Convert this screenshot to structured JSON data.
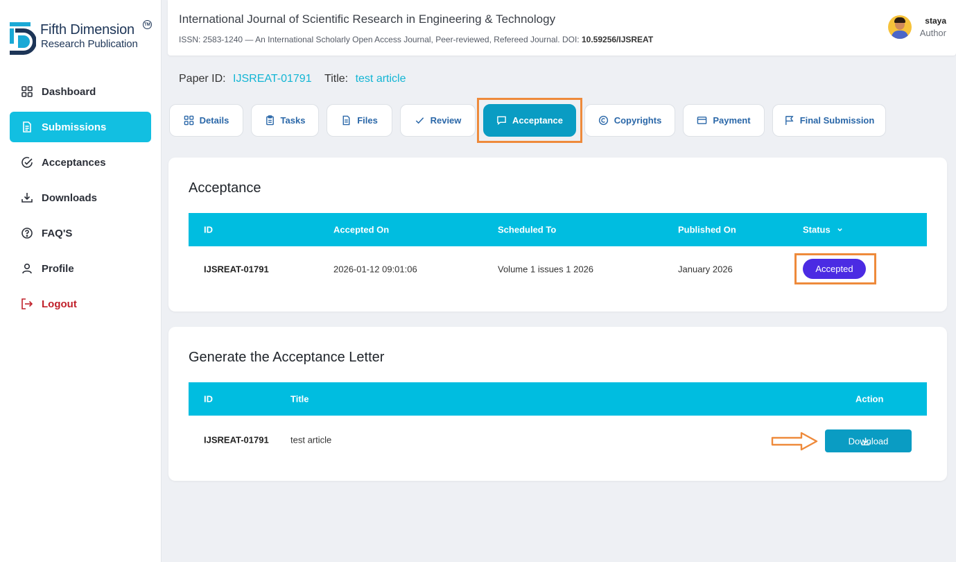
{
  "brand": {
    "line1": "Fifth Dimension",
    "line2": "Research Publication",
    "tm": "TM"
  },
  "sidebar": {
    "items": [
      {
        "label": "Dashboard",
        "icon": "grid-icon",
        "active": false
      },
      {
        "label": "Submissions",
        "icon": "document-icon",
        "active": true
      },
      {
        "label": "Acceptances",
        "icon": "check-circle-icon",
        "active": false
      },
      {
        "label": "Downloads",
        "icon": "download-icon",
        "active": false
      },
      {
        "label": "FAQ'S",
        "icon": "question-circle-icon",
        "active": false
      },
      {
        "label": "Profile",
        "icon": "user-icon",
        "active": false
      },
      {
        "label": "Logout",
        "icon": "logout-icon",
        "active": false
      }
    ]
  },
  "header": {
    "journal_title": "International Journal of Scientific Research in Engineering & Technology",
    "journal_sub": "ISSN: 2583-1240 — An International Scholarly Open Access Journal, Peer-reviewed, Refereed Journal. DOI: ",
    "doi": "10.59256/IJSREAT",
    "user_name": "staya",
    "user_role": "Author"
  },
  "paper": {
    "id_label": "Paper ID:",
    "id_value": "IJSREAT-01791",
    "title_label": "Title:",
    "title_value": "test article"
  },
  "tabs": [
    {
      "label": "Details",
      "icon": "grid-icon"
    },
    {
      "label": "Tasks",
      "icon": "clipboard-icon"
    },
    {
      "label": "Files",
      "icon": "file-icon"
    },
    {
      "label": "Review",
      "icon": "check-icon"
    },
    {
      "label": "Acceptance",
      "icon": "message-icon",
      "active": true
    },
    {
      "label": "Copyrights",
      "icon": "copyright-icon"
    },
    {
      "label": "Payment",
      "icon": "card-icon"
    },
    {
      "label": "Final Submission",
      "icon": "flag-icon"
    }
  ],
  "acceptance": {
    "title": "Acceptance",
    "columns": [
      "ID",
      "Accepted On",
      "Scheduled To",
      "Published On",
      "Status"
    ],
    "row": {
      "id": "IJSREAT-01791",
      "accepted_on": "2026-01-12 09:01:06",
      "scheduled_to": "Volume 1 issues 1 2026",
      "published_on": "January 2026",
      "status": "Accepted"
    }
  },
  "letter": {
    "title": "Generate the Acceptance Letter",
    "columns": [
      "ID",
      "Title",
      "Action"
    ],
    "row": {
      "id": "IJSREAT-01791",
      "title": "test article",
      "action_label": "Download"
    }
  },
  "colors": {
    "accent": "#12bfe1",
    "table_header": "#00bde0",
    "button": "#0a9cc3",
    "badge": "#4b2be3",
    "highlight": "#ee8a3b",
    "logout": "#c0202a"
  }
}
